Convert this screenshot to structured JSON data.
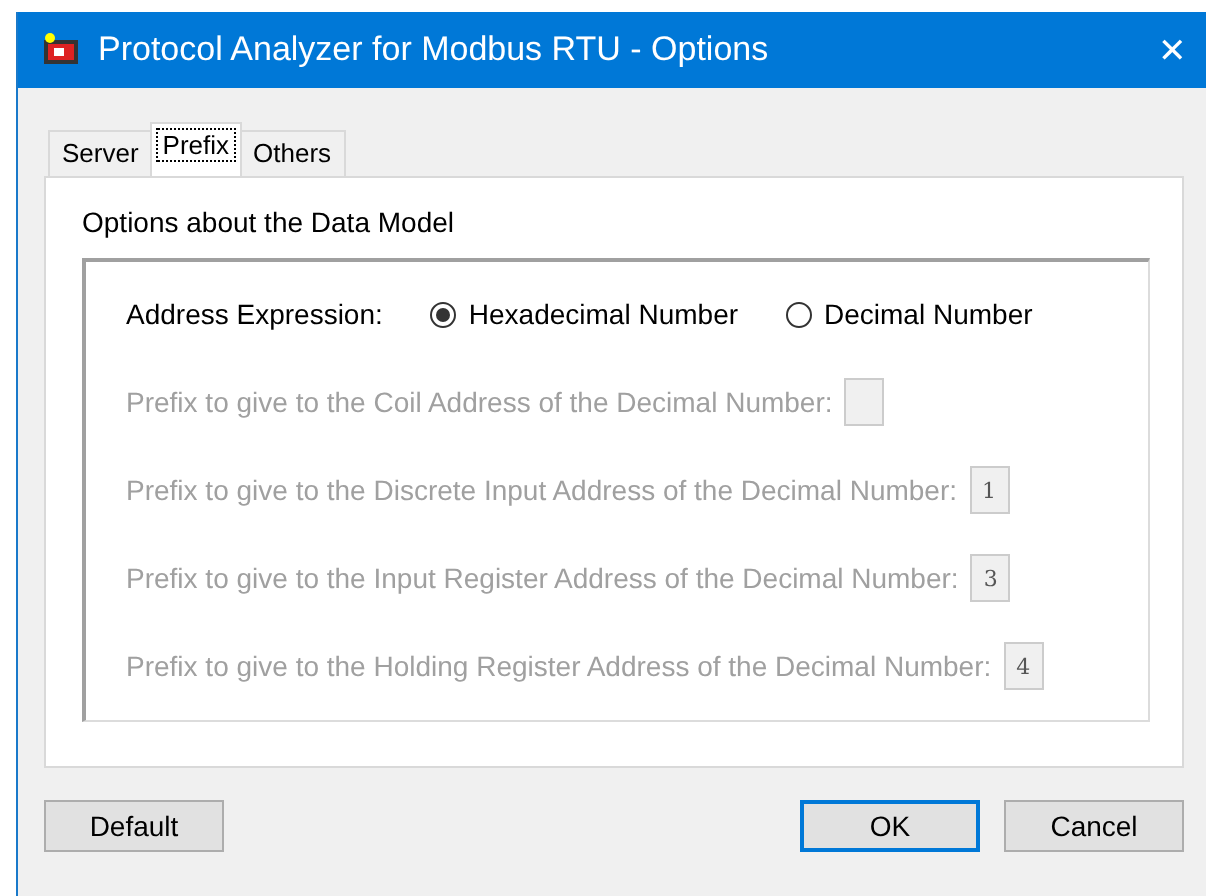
{
  "window": {
    "title": "Protocol Analyzer for Modbus RTU - Options",
    "close": "✕"
  },
  "tabs": [
    {
      "label": "Server",
      "selected": false
    },
    {
      "label": "Prefix",
      "selected": true
    },
    {
      "label": "Others",
      "selected": false
    }
  ],
  "panel": {
    "heading": "Options about the Data Model",
    "address_expression": {
      "label": "Address Expression:",
      "options": [
        {
          "label": "Hexadecimal Number",
          "selected": true
        },
        {
          "label": "Decimal Number",
          "selected": false
        }
      ]
    },
    "prefix_fields": [
      {
        "label": "Prefix to give to the Coil Address of the Decimal Number:",
        "disabled": true
      },
      {
        "label": "Prefix to give to the Discrete Input Address of the Decimal Number:",
        "value": "1",
        "disabled": true
      },
      {
        "label": "Prefix to give to the Input Register Address of the Decimal Number:",
        "value": "3",
        "disabled": true
      },
      {
        "label": "Prefix to give to the Holding Register Address of the Decimal Number:",
        "value": "4",
        "disabled": true
      }
    ]
  },
  "buttons": [
    {
      "label": "Default",
      "kind": "left",
      "default": false
    },
    {
      "label": "OK",
      "kind": "right",
      "default": true
    },
    {
      "label": "Cancel",
      "kind": "right",
      "default": false
    }
  ]
}
